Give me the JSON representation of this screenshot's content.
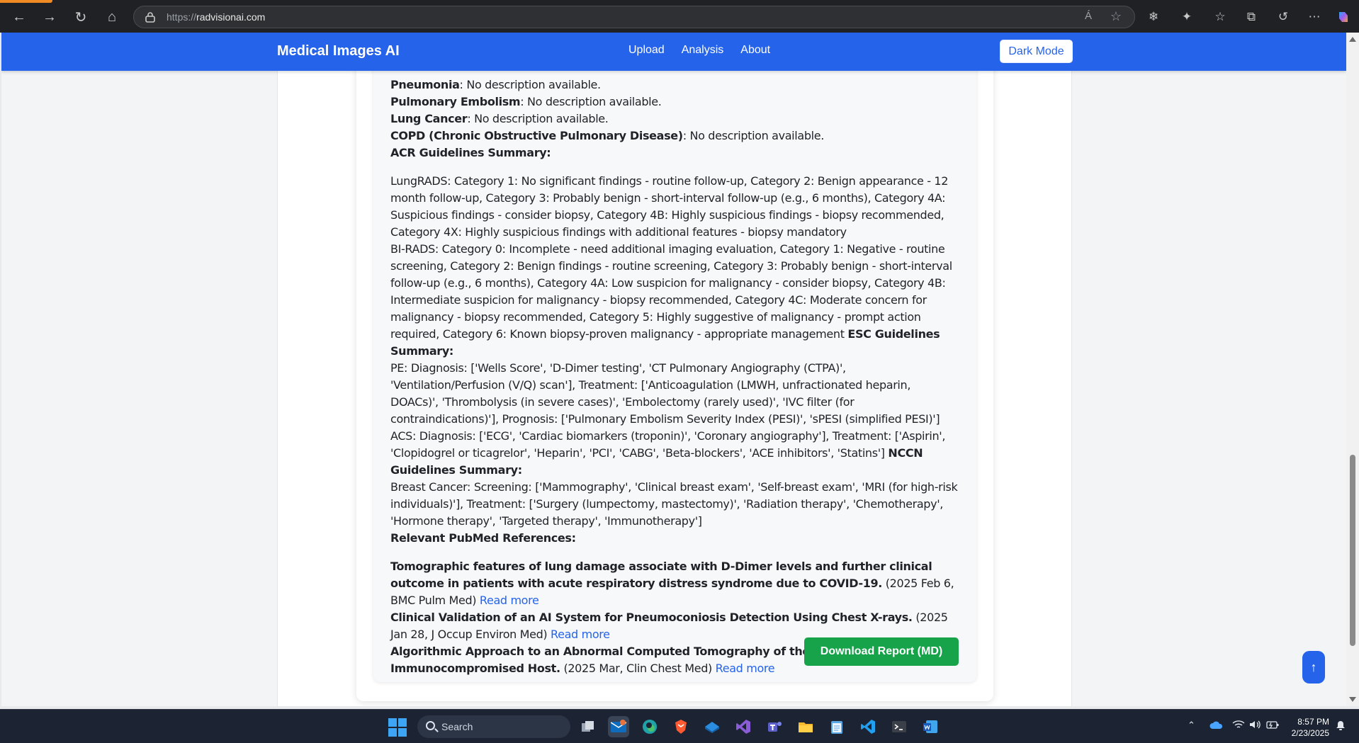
{
  "browser": {
    "url_scheme": "https://",
    "url_host": "radvisionai.com",
    "read_aloud_icon": "Á",
    "favorite_icon": "star"
  },
  "site": {
    "brand": "Medical Images AI",
    "nav": [
      "Upload",
      "Analysis",
      "About"
    ],
    "dark_mode_label": "Dark Mode",
    "accent_color": "#2563eb"
  },
  "conditions": [
    {
      "name": "Pneumonia",
      "desc": ": No description available."
    },
    {
      "name": "Pulmonary Embolism",
      "desc": ": No description available."
    },
    {
      "name": "Lung Cancer",
      "desc": ": No description available."
    },
    {
      "name": "COPD (Chronic Obstructive Pulmonary Disease)",
      "desc": ": No description available."
    }
  ],
  "acr_heading": "ACR Guidelines Summary:",
  "lungrads": "LungRADS: Category 1: No significant findings - routine follow-up, Category 2: Benign appearance - 12 month follow-up, Category 3: Probably benign - short-interval follow-up (e.g., 6 months), Category 4A: Suspicious findings - consider biopsy, Category 4B: Highly suspicious findings - biopsy recommended, Category 4X: Highly suspicious findings with additional features - biopsy mandatory",
  "birads": "BI-RADS: Category 0: Incomplete - need additional imaging evaluation, Category 1: Negative - routine screening, Category 2: Benign findings - routine screening, Category 3: Probably benign - short-interval follow-up (e.g., 6 months), Category 4A: Low suspicion for malignancy - consider biopsy, Category 4B: Intermediate suspicion for malignancy - biopsy recommended, Category 4C: Moderate concern for malignancy - biopsy recommended, Category 5: Highly suggestive of malignancy - prompt action required, Category 6: Known biopsy-proven malignancy - appropriate management",
  "esc_heading": "ESC Guidelines Summary:",
  "esc_pe": "PE: Diagnosis: ['Wells Score', 'D-Dimer testing', 'CT Pulmonary Angiography (CTPA)', 'Ventilation/Perfusion (V/Q) scan'], Treatment: ['Anticoagulation (LMWH, unfractionated heparin, DOACs)', 'Thrombolysis (in severe cases)', 'Embolectomy (rarely used)', 'IVC filter (for contraindications)'], Prognosis: ['Pulmonary Embolism Severity Index (PESI)', 'sPESI (simplified PESI)']",
  "esc_acs": "ACS: Diagnosis: ['ECG', 'Cardiac biomarkers (troponin)', 'Coronary angiography'], Treatment: ['Aspirin', 'Clopidogrel or ticagrelor', 'Heparin', 'PCI', 'CABG', 'Beta-blockers', 'ACE inhibitors', 'Statins']",
  "nccn_heading": "NCCN Guidelines Summary:",
  "nccn_breast": "Breast Cancer: Screening: ['Mammography', 'Clinical breast exam', 'Self-breast exam', 'MRI (for high-risk individuals)'], Treatment: ['Surgery (lumpectomy, mastectomy)', 'Radiation therapy', 'Chemotherapy', 'Hormone therapy', 'Targeted therapy', 'Immunotherapy']",
  "pubmed_heading": "Relevant PubMed References:",
  "references": [
    {
      "title": "Tomographic features of lung damage associate with D-Dimer levels and further clinical outcome in patients with acute respiratory distress syndrome due to COVID-19.",
      "meta": " (2025 Feb 6, BMC Pulm Med) ",
      "link": "Read more"
    },
    {
      "title": "Clinical Validation of an AI System for Pneumoconiosis Detection Using Chest X-rays.",
      "meta": " (2025 Jan 28, J Occup Environ Med) ",
      "link": "Read more"
    },
    {
      "title": "Algorithmic Approach to an Abnormal Computed Tomography of the Chest in the Immunocompromised Host.",
      "meta": " (2025 Mar, Clin Chest Med) ",
      "link": "Read more"
    }
  ],
  "download_label": "Download Report (MD)",
  "back_to_top_label": "↑",
  "taskbar": {
    "search_label": "Search",
    "time": "8:57 PM",
    "date": "2/23/2025"
  }
}
